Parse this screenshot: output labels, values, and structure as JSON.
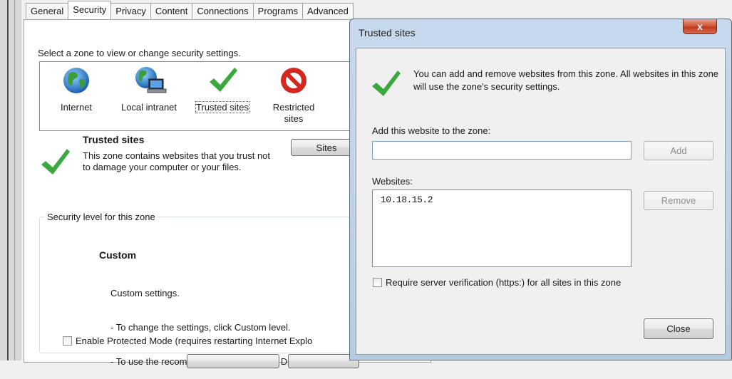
{
  "background_dialog": {
    "tabs": [
      "General",
      "Security",
      "Privacy",
      "Content",
      "Connections",
      "Programs",
      "Advanced"
    ],
    "zone_hint": "Select a zone to view or change security settings.",
    "zones": [
      {
        "label": "Internet",
        "icon": "globe-icon"
      },
      {
        "label": "Local intranet",
        "icon": "intranet-icon"
      },
      {
        "label": "Trusted sites",
        "icon": "checkmark-icon"
      },
      {
        "label": "Restricted sites",
        "icon": "prohibited-icon"
      }
    ],
    "selected_zone": {
      "title": "Trusted sites",
      "description": "This zone contains websites that you trust not to damage your computer or your files."
    },
    "sites_button": "Sites",
    "security_level_label": "Security level for this zone",
    "custom_title": "Custom",
    "custom_lines": [
      "Custom settings.",
      "- To change the settings, click Custom level.",
      "- To use the recommended settings, click Default le"
    ],
    "protected_mode_label": "Enable Protected Mode (requires restarting Internet Explo"
  },
  "trusted_sites_dialog": {
    "title": "Trusted sites",
    "close_glyph": "x",
    "info": "You can add and remove websites from this zone. All websites in this zone will use the zone's security settings.",
    "add_label": "Add this website to the zone:",
    "add_input_value": "",
    "add_button": "Add",
    "websites_label": "Websites:",
    "websites": [
      "10.18.15.2"
    ],
    "remove_button": "Remove",
    "require_label": "Require server verification (https:) for all sites in this zone",
    "require_checked": false,
    "close_button": "Close"
  },
  "colors": {
    "check_green": "#3aa83c",
    "prohibited_red": "#cf2020",
    "title_bar": "#c7d9ec",
    "close_red": "#c1391c"
  }
}
